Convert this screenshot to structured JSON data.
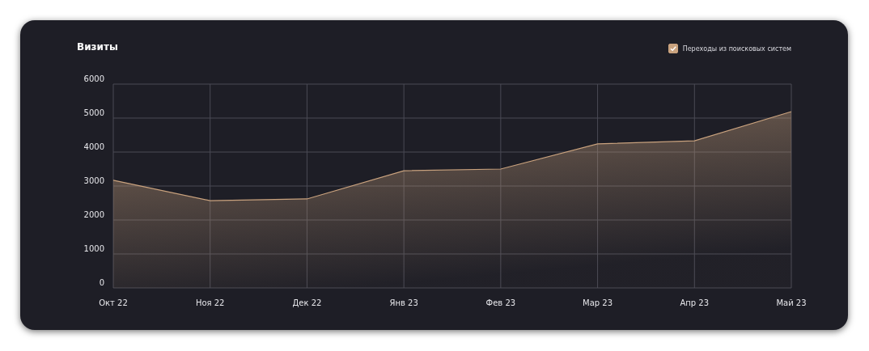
{
  "title": "Визиты",
  "legend": {
    "checked": true
  },
  "chart_data": {
    "type": "area",
    "categories": [
      "Окт 22",
      "Ноя 22",
      "Дек 22",
      "Янв 23",
      "Фев 23",
      "Мар 23",
      "Апр 23",
      "Май 23"
    ],
    "series": [
      {
        "name": "Переходы из поисковых систем",
        "color": "#c9a27e",
        "values": [
          3170,
          2570,
          2620,
          3450,
          3500,
          4240,
          4330,
          5190
        ]
      }
    ],
    "grid": true,
    "ylim": [
      0,
      6000
    ],
    "yticks": [
      0,
      1000,
      2000,
      3000,
      4000,
      5000,
      6000
    ]
  }
}
